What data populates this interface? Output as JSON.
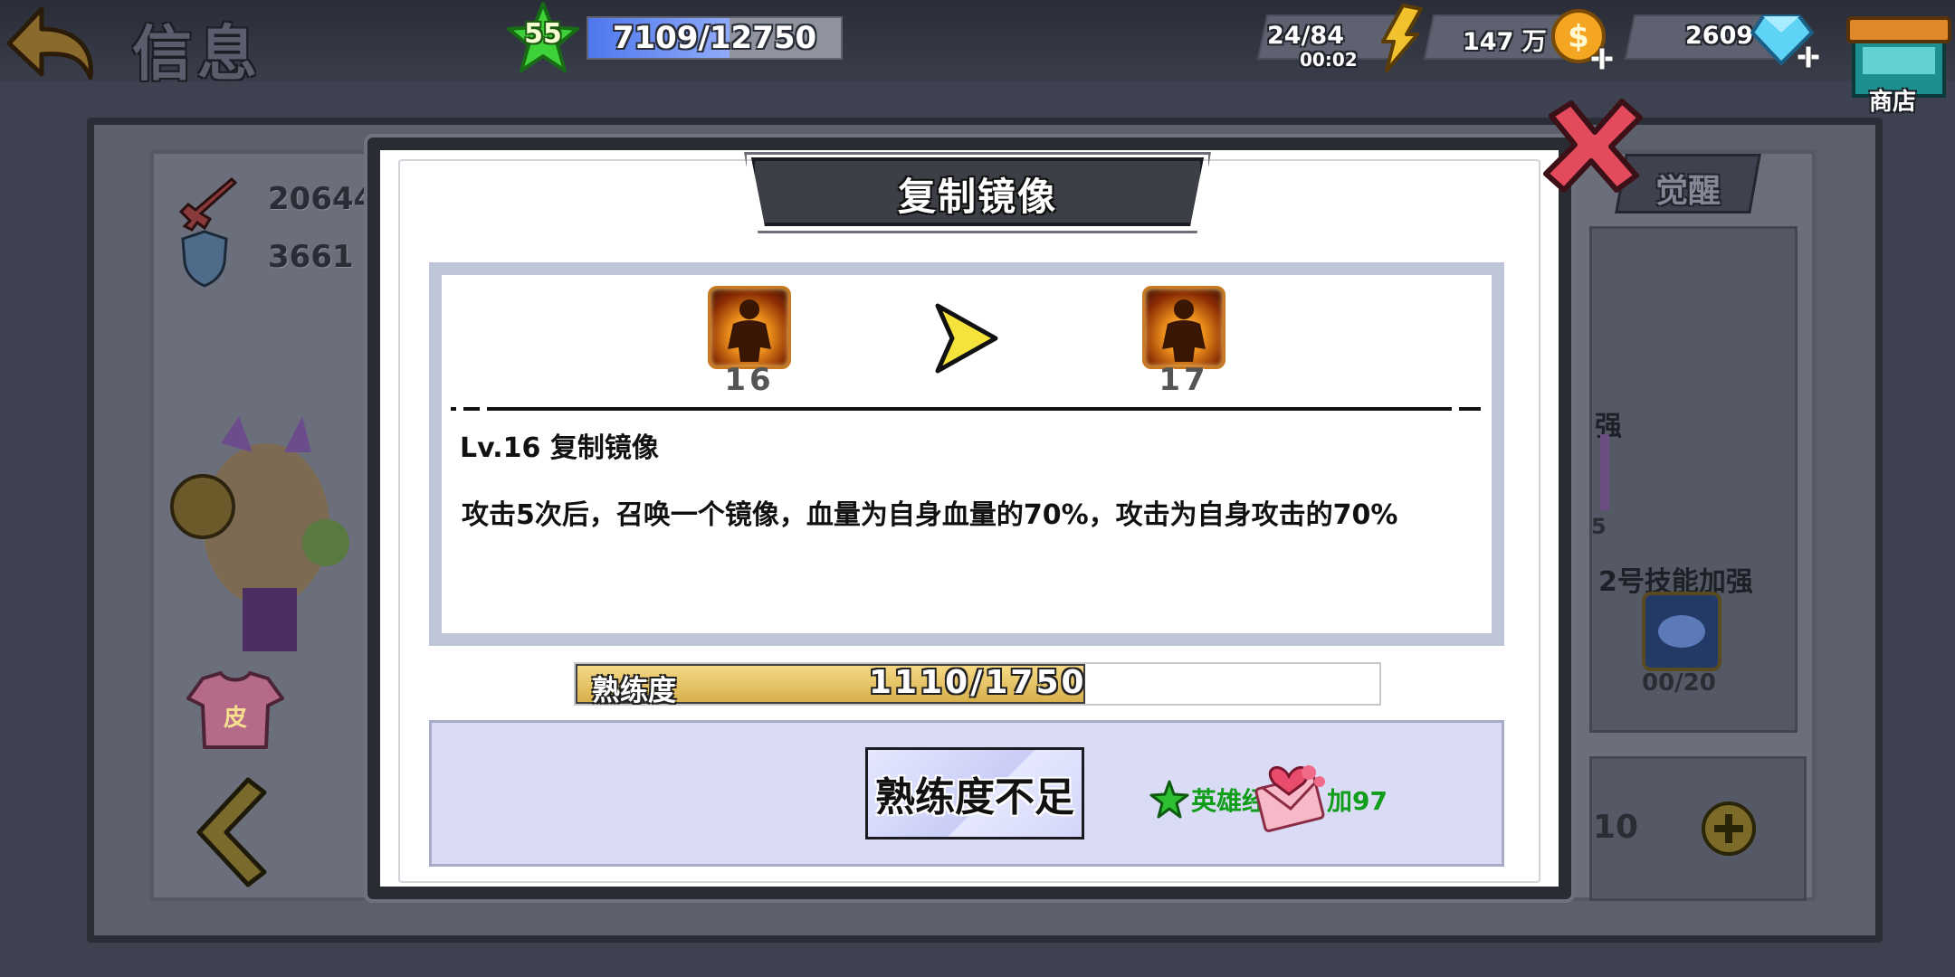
{
  "header": {
    "title": "信息",
    "player_level": "55",
    "xp_text": "7109/12750",
    "xp_progress": 0.558,
    "stamina_text": "24/84",
    "stamina_timer": "00:02",
    "gold_text": "147 万",
    "gems_text": "2609",
    "shop_label": "商店"
  },
  "background": {
    "attack_value": "20644",
    "defense_value": "3661",
    "awaken_tab": "觉醒",
    "skill_strengthen_label": "强",
    "skill2_strengthen_label": "2号技能加强",
    "skill2_progress": "00/20",
    "small_count": "5",
    "right_value": "10",
    "costume_label": "皮"
  },
  "modal": {
    "title": "复制镜像",
    "current_level": "16",
    "next_level": "17",
    "skill_heading": "Lv.16 复制镜像",
    "skill_description": "攻击5次后，召唤一个镜像，血量为自身血量的70%，攻击为自身攻击的70%",
    "proficiency_label": "熟练度",
    "proficiency_text": "1110/1750",
    "proficiency_progress": 0.634,
    "upgrade_button": "熟练度不足",
    "reward_text_prefix": "英雄经",
    "reward_text_suffix": "加97"
  },
  "colors": {
    "accent_green": "#0f9d1a",
    "xp_blue": "#4f78ee",
    "proficiency_gold": "#d8b04c"
  }
}
